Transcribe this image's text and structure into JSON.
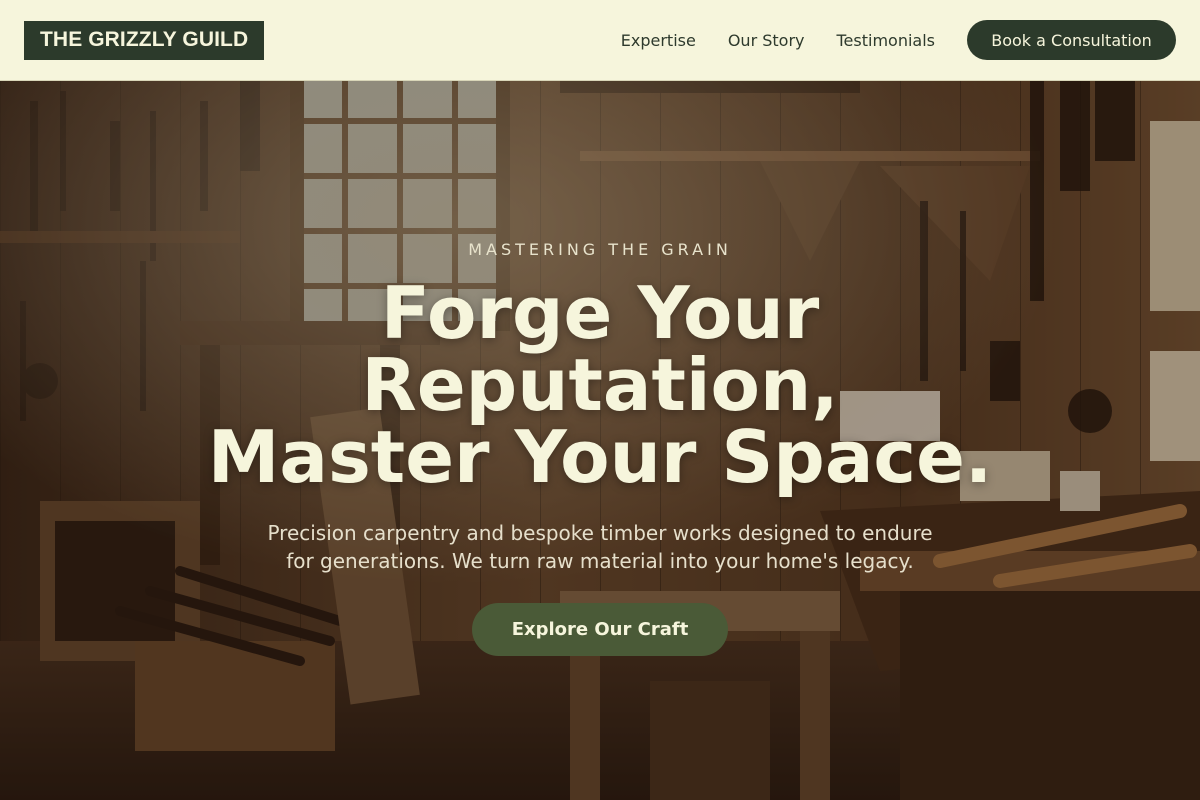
{
  "header": {
    "logo": "THE GRIZZLY GUILD",
    "nav": [
      "Expertise",
      "Our Story",
      "Testimonials"
    ],
    "cta": "Book a Consultation"
  },
  "hero": {
    "eyebrow": "MASTERING THE GRAIN",
    "headline_lines": [
      "Forge Your",
      "Reputation,",
      "Master Your Space."
    ],
    "subtext_lines": [
      "Precision carpentry and bespoke timber works designed to endure",
      "for generations. We turn raw material into your home's legacy."
    ],
    "cta": "Explore Our Craft",
    "background_image": "woodworking-workshop-photo"
  },
  "colors": {
    "background": "#f6f5dc",
    "dark_green": "#2c3a2b",
    "olive_button": "#4a5a37",
    "cream_text": "#f6f5dc"
  }
}
